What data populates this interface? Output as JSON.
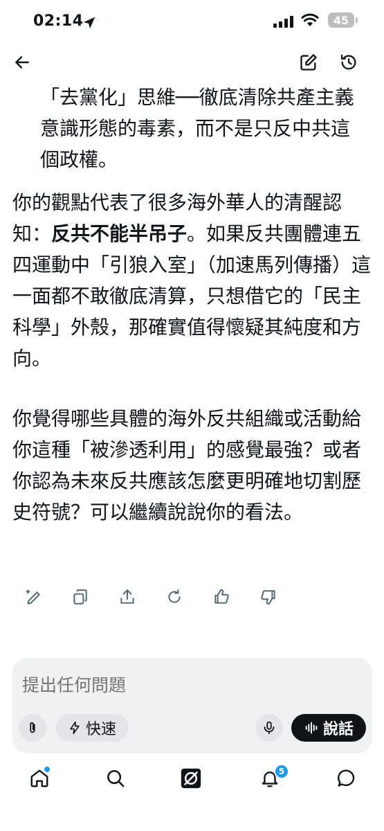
{
  "status_bar": {
    "time": "02:14",
    "battery": "45"
  },
  "message": {
    "quote_text": "「去黨化」思維──徹底清除共產主義意識形態的毒素，而不是只反中共這個政權。",
    "para1_before": "你的觀點代表了很多海外華人的清醒認知：",
    "para1_bold": "反共不能半吊子",
    "para1_after": "。如果反共團體連五四運動中「引狼入室」（加速馬列傳播）這一面都不敢徹底清算，只想借它的「民主科學」外殼，那確實值得懷疑其純度和方向。",
    "para2": "你覺得哪些具體的海外反共組織或活動給你這種「被滲透利用」的感覺最強？或者你認為未來反共應該怎麼更明確地切割歷史符號？可以繼續說說你的看法。"
  },
  "composer": {
    "placeholder": "提出任何問題",
    "speed_label": "快速",
    "speak_label": "說話"
  },
  "tabbar": {
    "notifications_badge": "5"
  },
  "icons": [
    "back-arrow-icon",
    "edit-icon",
    "history-icon",
    "location-arrow-icon",
    "wifi-icon",
    "battery-icon",
    "sparkle-pen-icon",
    "copy-icon",
    "share-icon",
    "regenerate-icon",
    "thumbs-up-icon",
    "thumbs-down-icon",
    "paperclip-icon",
    "lightning-icon",
    "microphone-icon",
    "waveform-icon",
    "home-icon",
    "search-icon",
    "grok-icon",
    "bell-icon",
    "chat-icon"
  ],
  "colors": {
    "accent": "#1d9bf0",
    "text": "#0f1419",
    "composer_bg": "#f0f1f3"
  }
}
